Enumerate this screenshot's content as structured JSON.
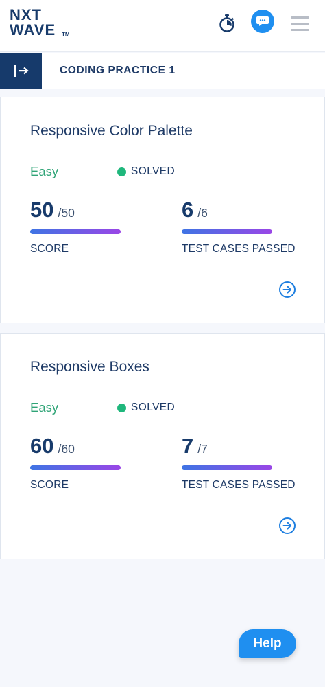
{
  "header": {
    "logo": {
      "line1": "NXT",
      "line2": "WAVE",
      "tm": "TM"
    },
    "icons": [
      "stopwatch-icon",
      "chat-icon",
      "hamburger-menu-icon"
    ]
  },
  "subheader": {
    "breadcrumb": "CODING PRACTICE 1"
  },
  "questions": [
    {
      "title": "Responsive Color Palette",
      "difficulty": "Easy",
      "status": "SOLVED",
      "score": {
        "value": "50",
        "total": "/50",
        "label": "SCORE",
        "progress": 1.0
      },
      "tests": {
        "value": "6",
        "total": "/6",
        "label": "TEST CASES PASSED",
        "progress": 1.0
      }
    },
    {
      "title": "Responsive Boxes",
      "difficulty": "Easy",
      "status": "SOLVED",
      "score": {
        "value": "60",
        "total": "/60",
        "label": "SCORE",
        "progress": 1.0
      },
      "tests": {
        "value": "7",
        "total": "/7",
        "label": "TEST CASES PASSED",
        "progress": 1.0
      }
    }
  ],
  "help": {
    "label": "Help"
  },
  "colors": {
    "brand_navy": "#163a6b",
    "accent_blue": "#1f8ff0",
    "easy_green": "#2fa477",
    "solved_green": "#1fb77c",
    "bar_start": "#3e74e4",
    "bar_end": "#9a46e6"
  }
}
